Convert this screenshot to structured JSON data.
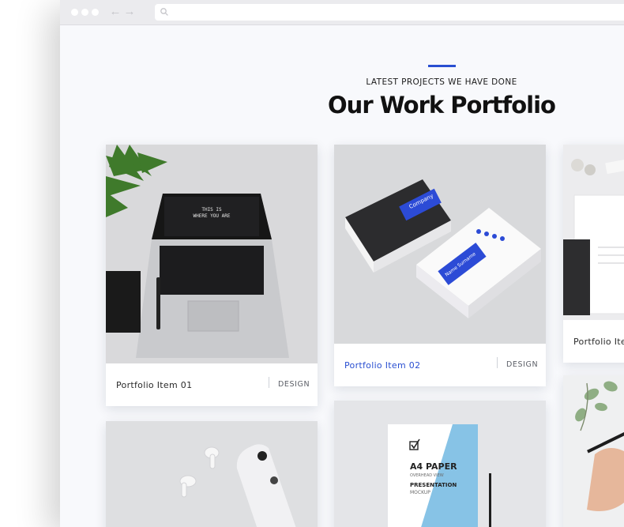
{
  "section": {
    "kicker": "LATEST PROJECTS WE HAVE DONE",
    "title": "Our Work Portfolio",
    "accent_color": "#2a4fd1"
  },
  "portfolio": [
    {
      "name": "Portfolio Item 01",
      "category": "DESIGN",
      "image": "laptop-desk"
    },
    {
      "name": "Portfolio Item 02",
      "category": "DESIGN",
      "image": "business-cards",
      "active": true
    },
    {
      "name": "Portfolio Ite",
      "category": "",
      "image": "stationery"
    },
    {
      "name": "",
      "category": "",
      "image": "phone-earbuds"
    },
    {
      "name": "",
      "category": "",
      "image": "a4-paper-mockup"
    },
    {
      "name": "",
      "category": "",
      "image": "hand-drawing"
    }
  ],
  "mockups": {
    "laptop_screen": [
      "THIS IS",
      "WHERE YOU ARE"
    ],
    "card_brand": "Company",
    "card_person": "Name Surname",
    "paper_title": "A4 PAPER",
    "paper_sub": "OVERHEAD VIEW",
    "paper_pres": "PRESENTATION",
    "paper_mock": "MOCKUP"
  }
}
